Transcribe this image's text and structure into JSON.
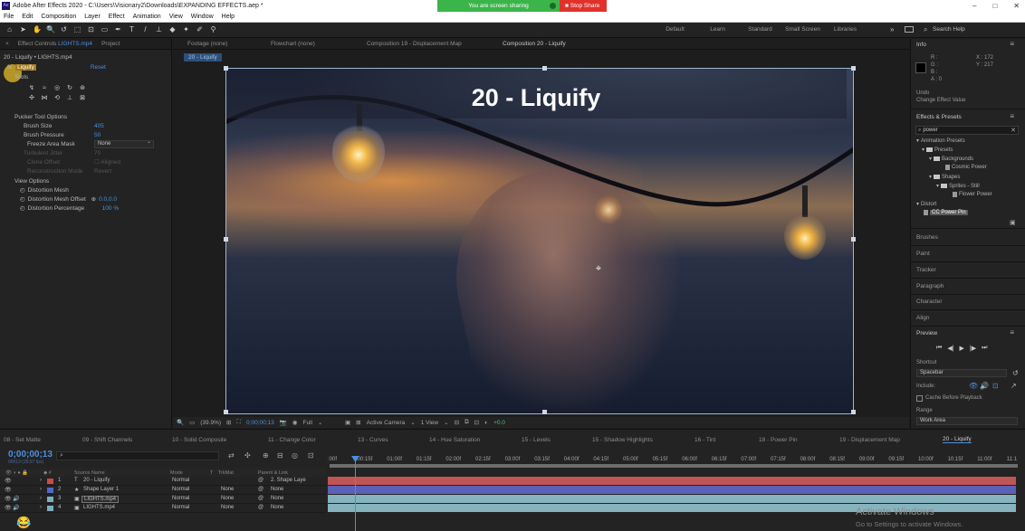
{
  "titlebar": {
    "title": "Adobe After Effects 2020 - C:\\Users\\Visionary2\\Downloads\\EXPANDING EFFECTS.aep *",
    "logo": "Ae",
    "sharing_text": "You are screen sharing",
    "stop_share": "Stop Share",
    "controls": [
      "–",
      "□",
      "✕"
    ]
  },
  "menu": [
    "File",
    "Edit",
    "Composition",
    "Layer",
    "Effect",
    "Animation",
    "View",
    "Window",
    "Help"
  ],
  "toolbar": {
    "tools": [
      "⌂",
      "➤",
      "✋",
      "🔍",
      "↺",
      "⬚",
      "⊡",
      "▭",
      "✒",
      "T",
      "/",
      "⊥",
      "◆",
      "✦",
      "✐",
      "⚲"
    ],
    "workspaces": [
      "Default",
      "Learn",
      "Standard",
      "Small Screen",
      "Libraries"
    ],
    "search_help": "Search Help"
  },
  "effect_controls": {
    "tab_label": "Effect Controls",
    "tab_file": "LIGHTS.mp4",
    "project_tab": "Project",
    "layer_path": "20 - Liquify • LIGHTS.mp4",
    "effect_name": "Liquify",
    "reset": "Reset",
    "tools_label": "Tools",
    "tool_icons": [
      "↯",
      "≈",
      "◎",
      "↻",
      "⊛",
      "✣",
      "⋈",
      "⟲",
      "⊥",
      "⊠"
    ],
    "pucker_options": "Pucker Tool Options",
    "brush_size_label": "Brush Size",
    "brush_size": "405",
    "brush_pressure_label": "Brush Pressure",
    "brush_pressure": "50",
    "freeze_mask_label": "Freeze Area Mask",
    "freeze_mask": "None",
    "turbulent_label": "Turbulent Jitter",
    "turbulent": "70",
    "clone_offset_label": "Clone Offset",
    "clone_aligned": "Aligned",
    "reconstruction_label": "Reconstruction Mode",
    "reconstruction": "Revert",
    "view_options": "View Options",
    "distortion_mesh": "Distortion Mesh",
    "mesh_offset_label": "Distortion Mesh Offset",
    "mesh_offset": "0.0,0.0",
    "distortion_pct_label": "Distortion Percentage",
    "distortion_pct": "100 %"
  },
  "composition": {
    "tabs": [
      "Footage (none)",
      "Flowchart (none)",
      "Composition 19 - Displacement Map",
      "Composition 20 - Liquify"
    ],
    "sub_tab": "20 - Liquify",
    "title": "20 - Liquify",
    "footer": {
      "zoom": "(39.9%)",
      "timecode": "0;00;00;13",
      "resolution": "Full",
      "camera": "Active Camera",
      "views": "1 View",
      "exposure": "+0.0"
    }
  },
  "info": {
    "title": "Info",
    "r": "R :",
    "g": "G :",
    "b": "B :",
    "a": "A : 0",
    "x": "X : 172",
    "y": "Y : 217",
    "undo": "Undo",
    "undo_action": "Change Effect Value"
  },
  "effects_presets": {
    "title": "Effects & Presets",
    "search": "power",
    "tree": [
      "Animation Presets",
      "Presets",
      "Backgrounds",
      "Cosmic Power",
      "Shapes",
      "Sprites - Still",
      "Flower Power",
      "Distort",
      "CC Power Pin"
    ],
    "collapsed": [
      "Brushes",
      "Paint",
      "Tracker",
      "Paragraph",
      "Character",
      "Align"
    ]
  },
  "preview": {
    "title": "Preview",
    "controls": [
      "⏮",
      "◀|",
      "▶",
      "|▶",
      "⏭"
    ],
    "shortcut_label": "Shortcut",
    "shortcut": "Spacebar",
    "include_label": "Include:",
    "cache_label": "Cache Before Playback",
    "range_label": "Range",
    "range": "Work Area"
  },
  "timeline": {
    "tabs": [
      "08 - Set Matte",
      "09 - Shift Channels",
      "10 - Solid Composite",
      "11 - Change Color",
      "13 - Curves",
      "14 - Hue Saturation",
      "15 - Levels",
      "15 - Shadow Highlights",
      "16 - Tint",
      "18 - Power Pin",
      "19 - Displacement Map",
      "20 - Liquify"
    ],
    "timecode": "0;00;00;13",
    "timecode_sub": "00013 (29.97 fps)",
    "search_glyph": "⌕",
    "columns": [
      "Source Name",
      "Mode",
      "T",
      "TrkMat",
      "Parent & Link"
    ],
    "layers": [
      {
        "num": "1",
        "type": "T",
        "name": "20 - Liquify",
        "mode": "Normal",
        "trkmat": "",
        "parent": "2. Shape Laye",
        "color": "#c84a4a"
      },
      {
        "num": "2",
        "type": "★",
        "name": "Shape Layer 1",
        "mode": "Normal",
        "trkmat": "None",
        "parent": "None",
        "color": "#5566c8"
      },
      {
        "num": "3",
        "type": "▣",
        "name": "LIGHTS.mp4",
        "mode": "Normal",
        "trkmat": "None",
        "parent": "None",
        "color": "#79b0c0"
      },
      {
        "num": "4",
        "type": "▣",
        "name": "LIGHTS.mp4",
        "mode": "Normal",
        "trkmat": "None",
        "parent": "None",
        "color": "#79b0c0"
      }
    ],
    "ruler": [
      ":00f",
      "00:15f",
      "01:00f",
      "01:15f",
      "02:00f",
      "02:15f",
      "03:00f",
      "03:15f",
      "04:00f",
      "04:15f",
      "05:00f",
      "05:15f",
      "06:00f",
      "06:15f",
      "07:00f",
      "07:15f",
      "08:00f",
      "08:15f",
      "09:00f",
      "09:15f",
      "10:00f",
      "10:15f",
      "11:00f",
      "11:1"
    ],
    "track_colors": [
      "#c05555",
      "#5b61b8",
      "#86b3be",
      "#86b3be"
    ]
  },
  "watermark": {
    "title": "Activate Windows",
    "sub": "Go to Settings to activate Windows."
  }
}
